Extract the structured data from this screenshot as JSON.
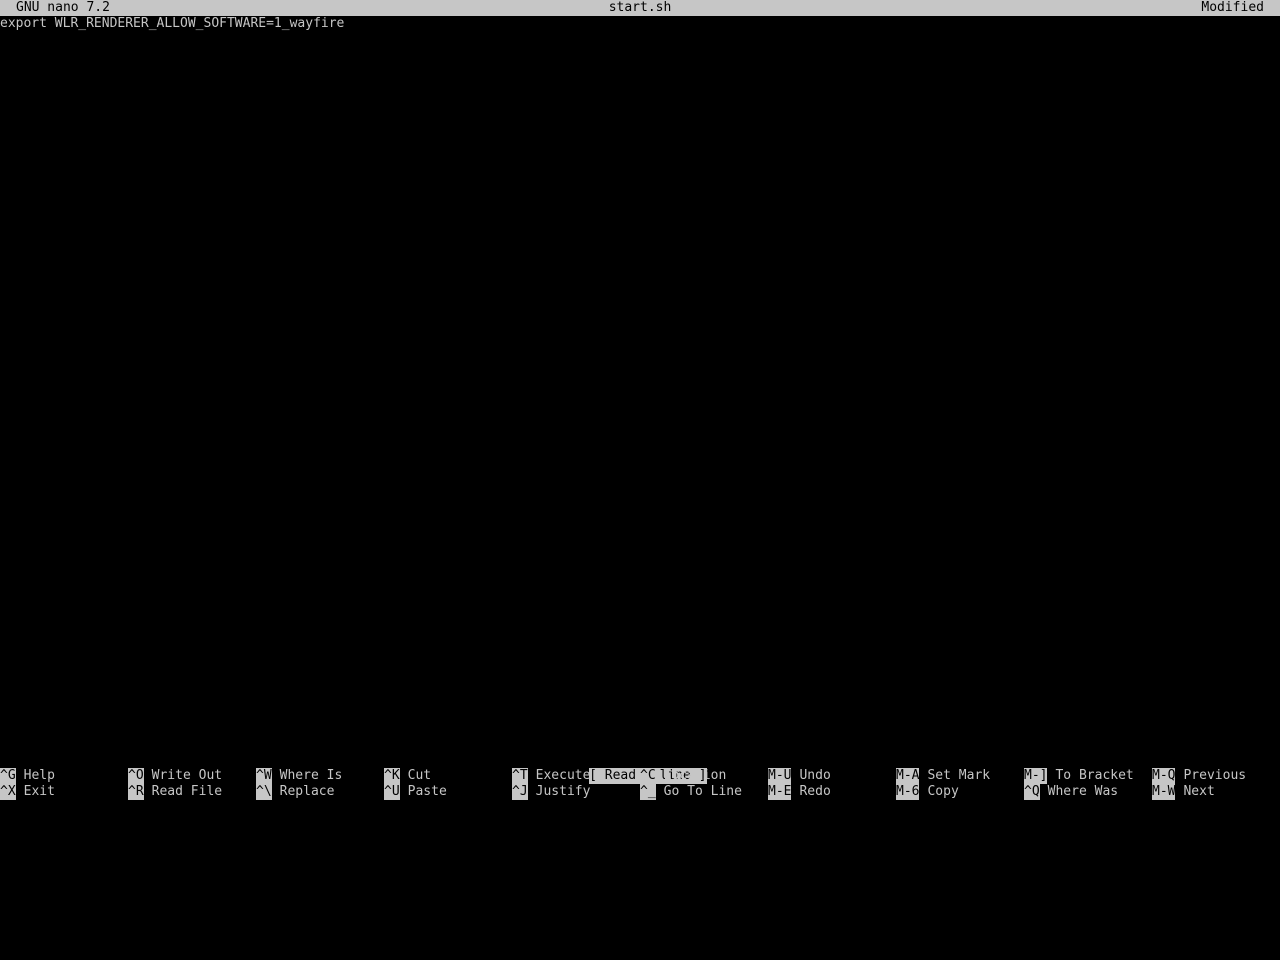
{
  "title_bar": {
    "app": "GNU nano 7.2",
    "file": "start.sh",
    "status": "Modified"
  },
  "editor": {
    "lines": [
      "export WLR_RENDERER_ALLOW_SOFTWARE=1_wayfire"
    ]
  },
  "status_message": "[ Read 1 line ]",
  "shortcuts_row1": [
    {
      "key": "^G",
      "label": "Help"
    },
    {
      "key": "^O",
      "label": "Write Out"
    },
    {
      "key": "^W",
      "label": "Where Is"
    },
    {
      "key": "^K",
      "label": "Cut"
    },
    {
      "key": "^T",
      "label": "Execute"
    },
    {
      "key": "^C",
      "label": "Location"
    },
    {
      "key": "M-U",
      "label": "Undo"
    },
    {
      "key": "M-A",
      "label": "Set Mark"
    },
    {
      "key": "M-]",
      "label": "To Bracket"
    },
    {
      "key": "M-Q",
      "label": "Previous"
    }
  ],
  "shortcuts_row2": [
    {
      "key": "^X",
      "label": "Exit"
    },
    {
      "key": "^R",
      "label": "Read File"
    },
    {
      "key": "^\\",
      "label": "Replace"
    },
    {
      "key": "^U",
      "label": "Paste"
    },
    {
      "key": "^J",
      "label": "Justify"
    },
    {
      "key": "^_",
      "label": "Go To Line"
    },
    {
      "key": "M-E",
      "label": "Redo"
    },
    {
      "key": "M-6",
      "label": "Copy"
    },
    {
      "key": "^Q",
      "label": "Where Was"
    },
    {
      "key": "M-W",
      "label": "Next"
    }
  ],
  "colors": {
    "background": "#000000",
    "foreground": "#c6c6c6",
    "inverse_bg": "#c6c6c6",
    "inverse_fg": "#000000"
  }
}
